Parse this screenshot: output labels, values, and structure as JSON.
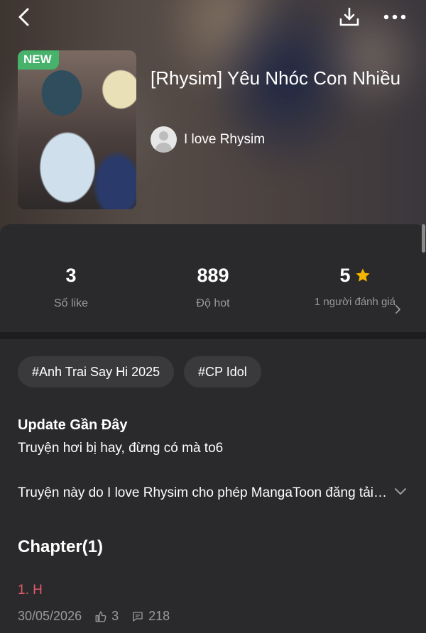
{
  "header": {
    "icons": [
      "back-arrow-icon",
      "download-icon",
      "more-dots-icon"
    ]
  },
  "comic": {
    "badge": "NEW",
    "title": "[Rhysim] Yêu Nhóc Con Nhiều",
    "author": "I love Rhysim"
  },
  "stats": {
    "likes": {
      "value": "3",
      "label": "Số like"
    },
    "hot": {
      "value": "889",
      "label": "Độ hot"
    },
    "rating": {
      "value": "5",
      "label": "1 người đánh giá",
      "star_color": "#f5b400"
    }
  },
  "tags": [
    "#Anh Trai Say Hi 2025",
    "#CP Idol"
  ],
  "update": {
    "heading": "Update Gần Đây",
    "text": "Truyện hơi bị hay, đừng có mà to6"
  },
  "description": "Truyện này do I love Rhysim cho phép MangaToon đăng tải độc quyền",
  "chapters": {
    "heading": "Chapter(1)",
    "items": [
      {
        "title": "1. H",
        "date": "30/05/2026",
        "likes": "3",
        "comments": "218"
      }
    ]
  },
  "colors": {
    "background": "#2a2a2c",
    "accent_red": "#e05a6a",
    "badge_green": "#46b26a",
    "muted_text": "#9a9a9a"
  }
}
